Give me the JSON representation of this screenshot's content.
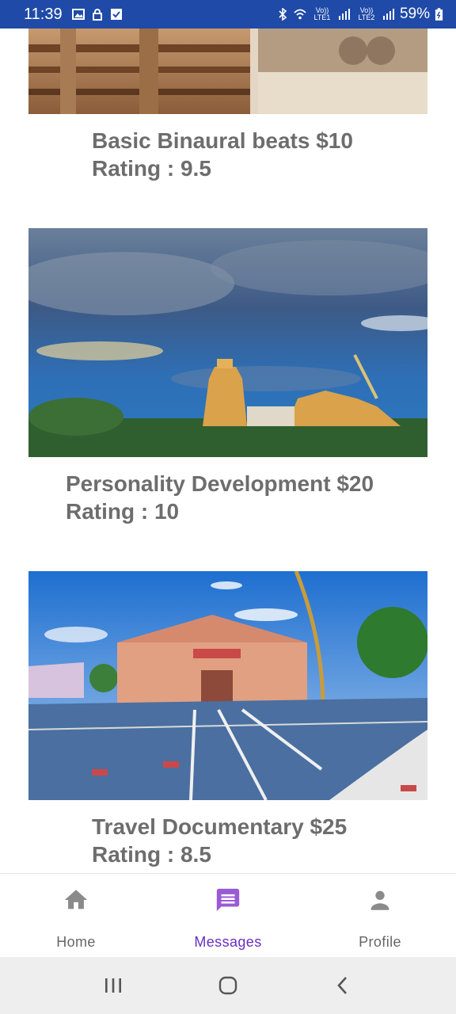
{
  "status_bar": {
    "time": "11:39",
    "battery": "59%",
    "sim1_label": "Vo)) LTE1",
    "sim2_label": "Vo)) LTE2"
  },
  "cards": [
    {
      "title": "Basic Binaural beats $10",
      "rating": "Rating : 9.5",
      "image": "temple-ruins-photo"
    },
    {
      "title": "Personality Development $20",
      "rating": "Rating : 10",
      "image": "temple-under-cloudy-sky-photo"
    },
    {
      "title": "Travel Documentary $25",
      "rating": "Rating : 8.5",
      "image": "temple-courtyard-photo"
    }
  ],
  "bottom_nav": {
    "items": [
      {
        "label": "Home",
        "icon": "home-icon",
        "active": false
      },
      {
        "label": "Messages",
        "icon": "message-icon",
        "active": true
      },
      {
        "label": "Profile",
        "icon": "person-icon",
        "active": false
      }
    ],
    "active_color": "#6a2fc2",
    "inactive_color": "#8a8a8a"
  },
  "system_nav": [
    "recents-button",
    "home-button",
    "back-button"
  ],
  "colors": {
    "status_bar": "#1f4aa8",
    "text": "#6d6d6d"
  }
}
